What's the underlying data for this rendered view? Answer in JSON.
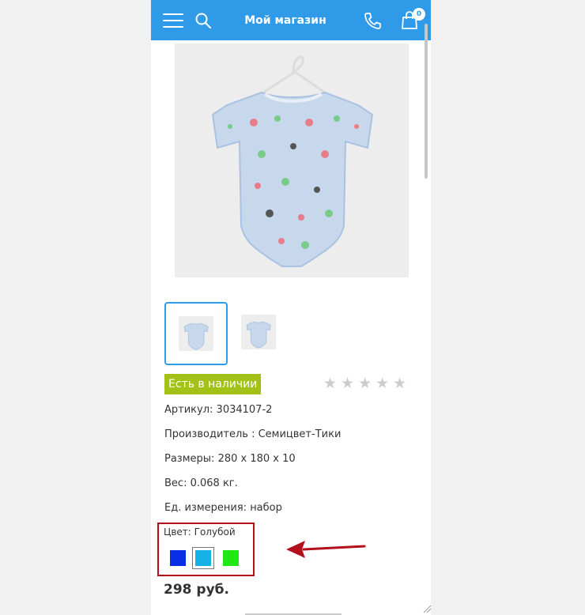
{
  "header": {
    "title": "Мой магазин",
    "cart_count": "0",
    "menu_icon": "hamburger-menu-icon",
    "search_icon": "search-icon",
    "phone_icon": "phone-icon",
    "cart_icon": "shopping-bag-icon",
    "bar_color": "#2f9ae8"
  },
  "product": {
    "stock_label": "Есть в наличии",
    "rating_stars": "★★★★★",
    "rating_value": 0,
    "rating_max": 5,
    "article_label": "Артикул:",
    "article_value": "3034107-2",
    "manufacturer_label": "Производитель :",
    "manufacturer_value": "Семицвет-Тики",
    "size_label": "Размеры:",
    "size_value": "280 x 180 x 10",
    "weight_label": "Вес:",
    "weight_value": "0.068 кг.",
    "unit_label": "Ед. измерения:",
    "unit_value": "набор",
    "color_label": "Цвет:",
    "color_value": "Голубой",
    "colors": [
      "#0a2ee6",
      "#16b1e4",
      "#21e815"
    ],
    "selected_color_index": 1,
    "price": "298 руб."
  },
  "gallery": {
    "selected_thumb_index": 0,
    "thumb_count": 2
  }
}
